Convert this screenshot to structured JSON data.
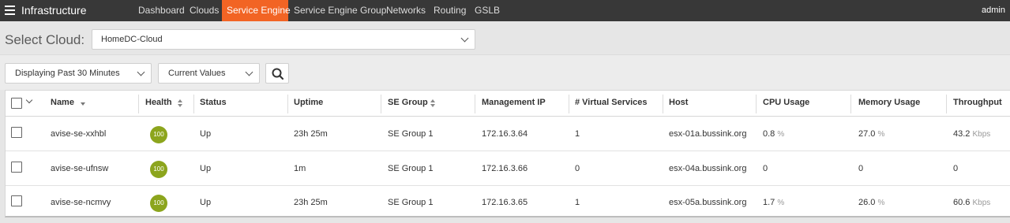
{
  "app": {
    "title": "Infrastructure",
    "user": "admin",
    "menu_icon": "hamburger-menu-icon"
  },
  "nav": {
    "tabs": [
      {
        "label": "Dashboard",
        "active": false
      },
      {
        "label": "Clouds",
        "active": false
      },
      {
        "label": "Service Engine",
        "active": true
      },
      {
        "label": "Service Engine Group",
        "active": false
      },
      {
        "label": "Networks",
        "active": false
      },
      {
        "label": "Routing",
        "active": false
      },
      {
        "label": "GSLB",
        "active": false
      }
    ]
  },
  "cloud": {
    "label": "Select Cloud:",
    "value": "HomeDC-Cloud"
  },
  "filters": {
    "time_range": "Displaying Past 30 Minutes",
    "values_mode": "Current Values",
    "search_icon": "search-icon"
  },
  "colors": {
    "accent": "#f26424",
    "nav_bg": "#383838",
    "health_good": "#8ca51d"
  },
  "table": {
    "headers": {
      "name": "Name",
      "health": "Health",
      "status": "Status",
      "uptime": "Uptime",
      "se_group": "SE Group",
      "mgmt_ip": "Management IP",
      "vs": "# Virtual Services",
      "host": "Host",
      "cpu": "CPU Usage",
      "memory": "Memory Usage",
      "throughput": "Throughput"
    },
    "rows": [
      {
        "name": "avise-se-xxhbl",
        "health": "100",
        "status": "Up",
        "uptime": "23h 25m",
        "se_group": "SE Group 1",
        "mgmt_ip": "172.16.3.64",
        "vs": "1",
        "host": "esx-01a.bussink.org",
        "cpu": "0.8",
        "cpu_unit": "%",
        "memory": "27.0",
        "memory_unit": "%",
        "throughput": "43.2",
        "throughput_unit": "Kbps"
      },
      {
        "name": "avise-se-ufnsw",
        "health": "100",
        "status": "Up",
        "uptime": "1m",
        "se_group": "SE Group 1",
        "mgmt_ip": "172.16.3.66",
        "vs": "0",
        "host": "esx-04a.bussink.org",
        "cpu": "0",
        "cpu_unit": "",
        "memory": "0",
        "memory_unit": "",
        "throughput": "0",
        "throughput_unit": ""
      },
      {
        "name": "avise-se-ncmvy",
        "health": "100",
        "status": "Up",
        "uptime": "23h 25m",
        "se_group": "SE Group 1",
        "mgmt_ip": "172.16.3.65",
        "vs": "1",
        "host": "esx-05a.bussink.org",
        "cpu": "1.7",
        "cpu_unit": "%",
        "memory": "26.0",
        "memory_unit": "%",
        "throughput": "60.6",
        "throughput_unit": "Kbps"
      }
    ]
  }
}
